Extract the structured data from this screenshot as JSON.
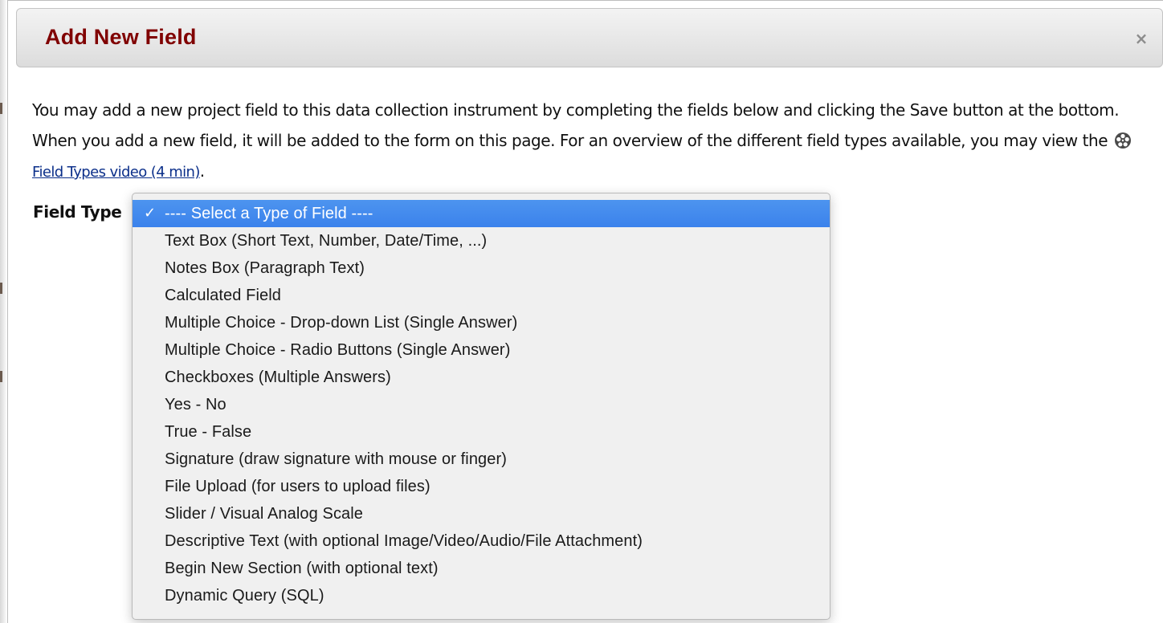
{
  "dialog": {
    "title": "Add New Field",
    "close_symbol": "×"
  },
  "intro": {
    "text_before_link": "You may add a new project field to this data collection instrument by completing the fields below and clicking the Save button at the bottom. When you add a new field, it will be added to the form on this page. For an overview of the different field types available, you may view the",
    "video_icon": "film-reel-icon",
    "link_text": "Field Types video (4 min)",
    "text_after_link": "."
  },
  "field_type": {
    "label": "Field Type",
    "selected_index": 0,
    "check_symbol": "✓",
    "options": [
      "---- Select a Type of Field ----",
      "Text Box (Short Text, Number, Date/Time, ...)",
      "Notes Box (Paragraph Text)",
      "Calculated Field",
      "Multiple Choice - Drop-down List (Single Answer)",
      "Multiple Choice - Radio Buttons (Single Answer)",
      "Checkboxes (Multiple Answers)",
      "Yes - No",
      "True - False",
      "Signature (draw signature with mouse or finger)",
      "File Upload (for users to upload files)",
      "Slider / Visual Analog Scale",
      "Descriptive Text (with optional Image/Video/Audio/File Attachment)",
      "Begin New Section (with optional text)",
      "Dynamic Query (SQL)"
    ]
  },
  "colors": {
    "title": "#800000",
    "link": "#0b2f8a",
    "selection": "#3b82ec"
  }
}
